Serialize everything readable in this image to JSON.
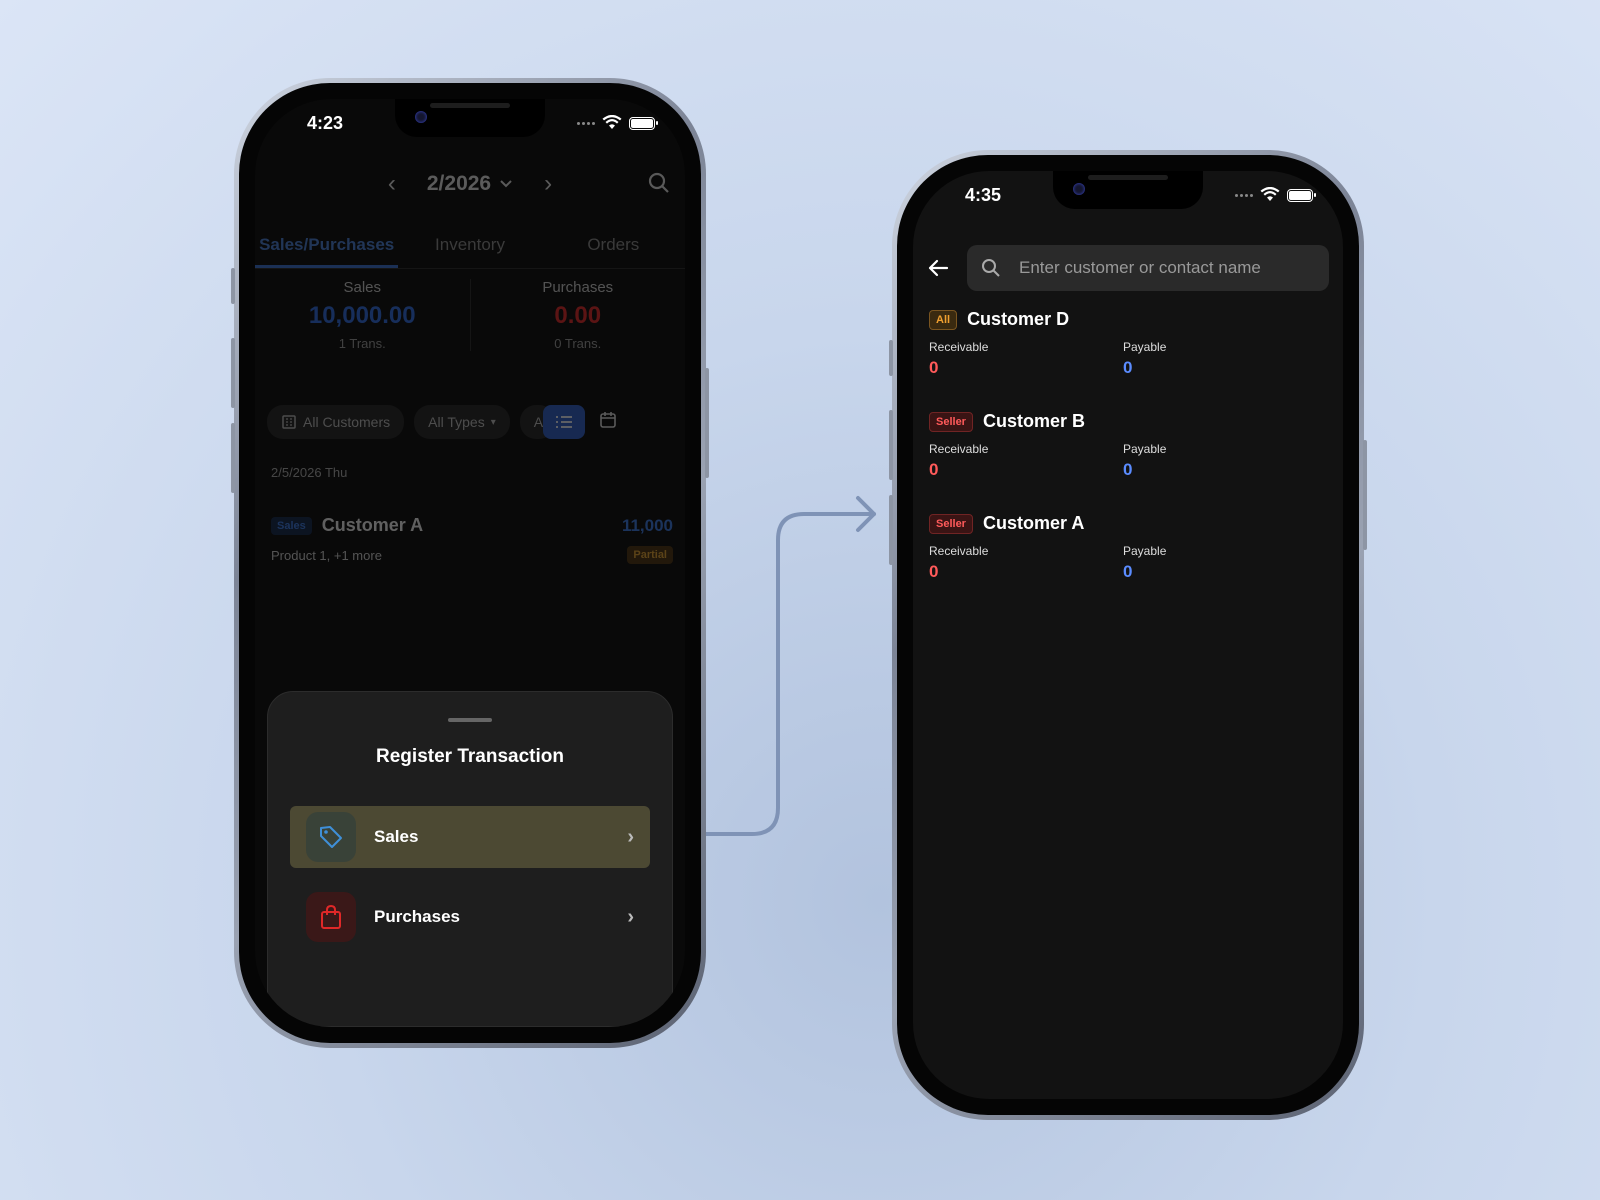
{
  "left_phone": {
    "status": {
      "time": "4:23"
    },
    "header": {
      "month": "2/2026"
    },
    "tabs": [
      {
        "label": "Sales/Purchases",
        "active": true
      },
      {
        "label": "Inventory",
        "active": false
      },
      {
        "label": "Orders",
        "active": false
      }
    ],
    "summary": {
      "sales_label": "Sales",
      "sales_value": "10,000.00",
      "sales_count": "1 Trans.",
      "purchases_label": "Purchases",
      "purchases_value": "0.00",
      "purchases_count": "0 Trans."
    },
    "filters": {
      "customers": "All Customers",
      "types": "All Types",
      "status": "All"
    },
    "date_header": "2/5/2026 Thu",
    "transaction": {
      "badge": "Sales",
      "name": "Customer A",
      "amount": "11,000",
      "items": "Product 1, +1 more",
      "status": "Partial"
    },
    "sheet": {
      "title": "Register Transaction",
      "options": [
        {
          "label": "Sales",
          "icon": "tag-icon"
        },
        {
          "label": "Purchases",
          "icon": "shopping-bag-icon"
        }
      ]
    }
  },
  "right_phone": {
    "status": {
      "time": "4:35"
    },
    "search": {
      "placeholder": "Enter customer or contact name"
    },
    "customers": [
      {
        "badge": "All",
        "name": "Customer D",
        "receivable_label": "Receivable",
        "receivable": "0",
        "payable_label": "Payable",
        "payable": "0"
      },
      {
        "badge": "Seller",
        "name": "Customer B",
        "receivable_label": "Receivable",
        "receivable": "0",
        "payable_label": "Payable",
        "payable": "0"
      },
      {
        "badge": "Seller",
        "name": "Customer A",
        "receivable_label": "Receivable",
        "receivable": "0",
        "payable_label": "Payable",
        "payable": "0"
      }
    ]
  },
  "colors": {
    "accent_blue": "#3a78e0",
    "sales_blue": "#2f6ce0",
    "purchases_red": "#e02828",
    "receivable_red": "#ff5a5a",
    "payable_blue": "#5b8cff",
    "selected_option": "#4c4933"
  }
}
